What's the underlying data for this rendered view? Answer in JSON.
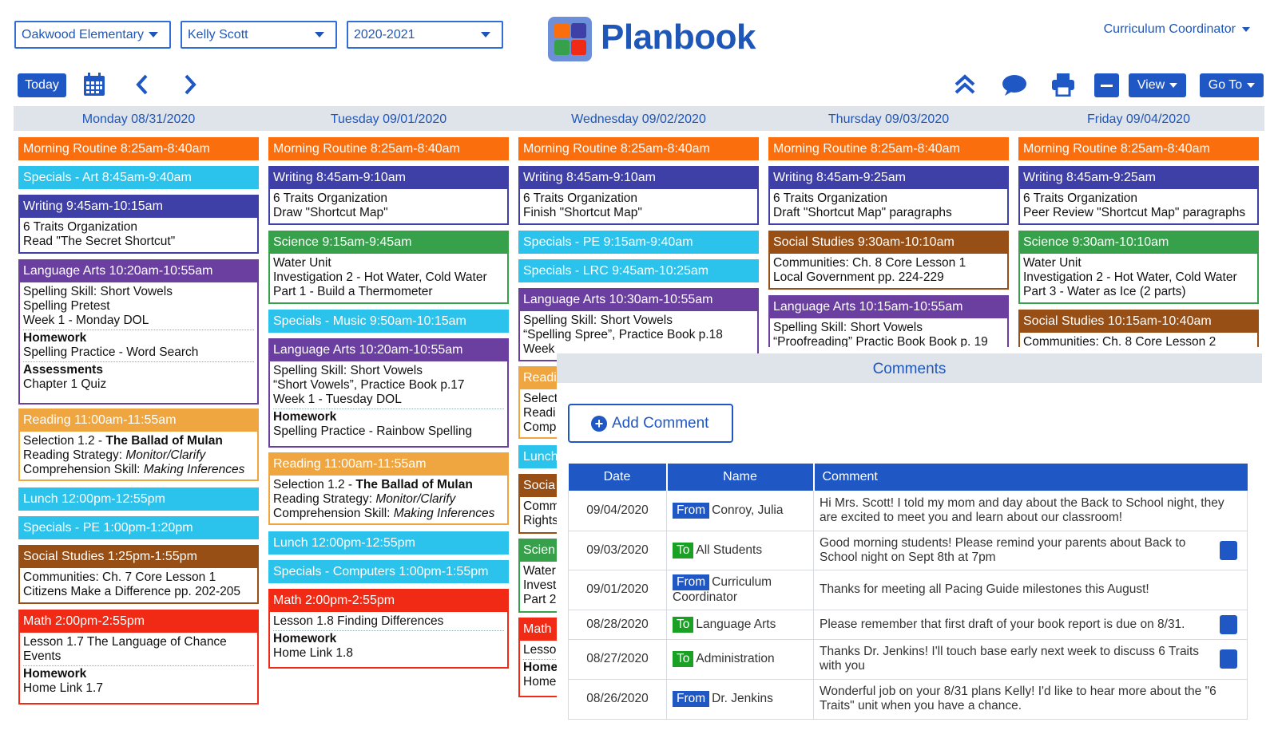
{
  "selectors": {
    "school": "Oakwood Elementary",
    "teacher": "Kelly Scott",
    "year": "2020-2021"
  },
  "brand": "Planbook",
  "role": "Curriculum Coordinator",
  "toolbar": {
    "today": "Today",
    "view": "View",
    "goto": "Go To",
    "icons": [
      "calendar-icon",
      "chevron-left-icon",
      "chevron-right-icon",
      "collapse-up-icon",
      "comment-icon",
      "print-icon",
      "minus-icon"
    ]
  },
  "days": [
    "Monday 08/31/2020",
    "Tuesday 09/01/2020",
    "Wednesday 09/02/2020",
    "Thursday 09/03/2020",
    "Friday 09/04/2020"
  ],
  "colors": {
    "orange": "#fb6e0e",
    "cyan": "#2bc3ec",
    "indigo": "#3f3fa8",
    "purple": "#6b3fa0",
    "amber": "#f0a640",
    "brown": "#974f16",
    "red": "#f02a14",
    "green": "#36a04a",
    "accent": "#1f57c4"
  },
  "monday": {
    "l1": "Morning Routine 8:25am-8:40am",
    "l2": "Specials - Art 8:45am-9:40am",
    "l3": "Writing 9:45am-10:15am",
    "l3b": [
      "6 Traits Organization",
      "Read \"The Secret Shortcut\""
    ],
    "l4": "Language Arts 10:20am-10:55am",
    "l4b": [
      "Spelling Skill: Short Vowels",
      "Spelling Pretest",
      "Week 1 - Monday DOL"
    ],
    "l4h": "Homework",
    "l4hb": "Spelling Practice - Word Search",
    "l4a": "Assessments",
    "l4ab": " Chapter 1 Quiz",
    "l5": "Reading 11:00am-11:55am",
    "l5b1a": "Selection 1.2 - ",
    "l5b1b": "The Ballad of Mulan",
    "l5b2a": "Reading Strategy: ",
    "l5b2b": "Monitor/Clarify",
    "l5b3a": "Comprehension Skill: ",
    "l5b3b": "Making Inferences",
    "l6": "Lunch 12:00pm-12:55pm",
    "l7": "Specials - PE 1:00pm-1:20pm",
    "l8": "Social Studies 1:25pm-1:55pm",
    "l8b": [
      "Communities: Ch. 7 Core Lesson 1",
      "Citizens Make a Difference pp. 202-205"
    ],
    "l9": "Math 2:00pm-2:55pm",
    "l9b": [
      "Lesson 1.7 The Language of Chance",
      "Events"
    ],
    "l9h": "Homework",
    "l9hb": "Home Link 1.7"
  },
  "tuesday": {
    "l1": "Morning Routine 8:25am-8:40am",
    "l2": "Writing 8:45am-9:10am",
    "l2b": [
      "6 Traits Organization",
      "Draw \"Shortcut Map\""
    ],
    "l3": "Science 9:15am-9:45am",
    "l3b": [
      "Water Unit",
      "Investigation 2 - Hot Water, Cold Water",
      "Part 1 - Build a Thermometer"
    ],
    "l4": "Specials - Music 9:50am-10:15am",
    "l5": "Language Arts 10:20am-10:55am",
    "l5b": [
      "Spelling Skill: Short Vowels",
      "“Short Vowels”, Practice Book p.17",
      "Week 1 - Tuesday DOL"
    ],
    "l5h": "Homework",
    "l5hb": "Spelling Practice - Rainbow Spelling",
    "l6": "Reading 11:00am-11:55am",
    "l6b1a": "Selection 1.2 - ",
    "l6b1b": "The Ballad of Mulan",
    "l6b2a": "Reading Strategy: ",
    "l6b2b": "Monitor/Clarify",
    "l6b3a": "Comprehension Skill: ",
    "l6b3b": "Making Inferences",
    "l7": "Lunch 12:00pm-12:55pm",
    "l8": "Specials - Computers 1:00pm-1:55pm",
    "l9": "Math 2:00pm-2:55pm",
    "l9b": "Lesson 1.8 Finding Differences",
    "l9h": "Homework",
    "l9hb": "Home Link 1.8"
  },
  "wednesday": {
    "l1": "Morning Routine 8:25am-8:40am",
    "l2": "Writing 8:45am-9:10am",
    "l2b": [
      "6 Traits Organization",
      "Finish \"Shortcut Map\""
    ],
    "l3": "Specials - PE 9:15am-9:40am",
    "l4": "Specials - LRC 9:45am-10:25am",
    "l5": "Language Arts 10:30am-10:55am",
    "l5b": [
      "Spelling Skill: Short Vowels",
      "“Spelling Spree”, Practice Book p.18",
      "Week"
    ],
    "l6": "Readi",
    "l6b": [
      "Select",
      "Readi",
      "Comp"
    ],
    "l7": "Lunch",
    "l8": "Socia",
    "l8b": [
      "Comm",
      "Rights"
    ],
    "l9": "Scien",
    "l9b": [
      "Water",
      "Invest",
      "Part 2"
    ],
    "l10": "Math",
    "l10b": "Lesso",
    "l10h": "Home",
    "l10hb": "Home"
  },
  "thursday": {
    "l1": "Morning Routine 8:25am-8:40am",
    "l2": "Writing 8:45am-9:25am",
    "l2b": [
      "6 Traits Organization",
      "Draft \"Shortcut Map\" paragraphs"
    ],
    "l3": "Social Studies 9:30am-10:10am",
    "l3b": [
      "Communities: Ch. 8 Core Lesson 1",
      "Local Government pp. 224-229"
    ],
    "l4": "Language Arts 10:15am-10:55am",
    "l4b": [
      "Spelling Skill: Short Vowels",
      "“Proofreading” Practic Book Book p. 19"
    ]
  },
  "friday": {
    "l1": "Morning Routine 8:25am-8:40am",
    "l2": "Writing 8:45am-9:25am",
    "l2b": [
      "6 Traits Organization",
      "Peer Review \"Shortcut Map\" paragraphs"
    ],
    "l3": "Science 9:30am-10:10am",
    "l3b": [
      "Water Unit",
      "Investigation 2 - Hot Water, Cold Water",
      "Part 3 - Water as Ice (2 parts)"
    ],
    "l4": "Social Studies 10:15am-10:40am",
    "l4b": [
      "Communities: Ch. 8 Core Lesson 2"
    ]
  },
  "comments": {
    "title": "Comments",
    "add": "Add Comment",
    "headers": [
      "Date",
      "Name",
      "Comment"
    ],
    "rows": [
      {
        "date": "09/04/2020",
        "dir": "From",
        "name": "Conroy, Julia",
        "text": "Hi Mrs. Scott! I told my mom and day about the Back to School night, they are excited to meet you and learn about our classroom!"
      },
      {
        "date": "09/03/2020",
        "dir": "To",
        "name": "All Students",
        "text": "Good morning students! Please remind your parents about Back to School night on Sept 8th at 7pm"
      },
      {
        "date": "09/01/2020",
        "dir": "From",
        "name": "Curriculum Coordinator",
        "text": "Thanks for meeting all Pacing Guide milestones this August!"
      },
      {
        "date": "08/28/2020",
        "dir": "To",
        "name": "Language Arts",
        "text": "Please remember that first draft of your book report is due on 8/31."
      },
      {
        "date": "08/27/2020",
        "dir": "To",
        "name": "Administration",
        "text": "Thanks Dr. Jenkins!  I'll touch base early next week to discuss 6 Traits with you"
      },
      {
        "date": "08/26/2020",
        "dir": "From",
        "name": "Dr. Jenkins",
        "text": "Wonderful job on your 8/31 plans Kelly! I'd like to hear more about the \"6 Traits\" unit when you have a chance."
      }
    ]
  }
}
